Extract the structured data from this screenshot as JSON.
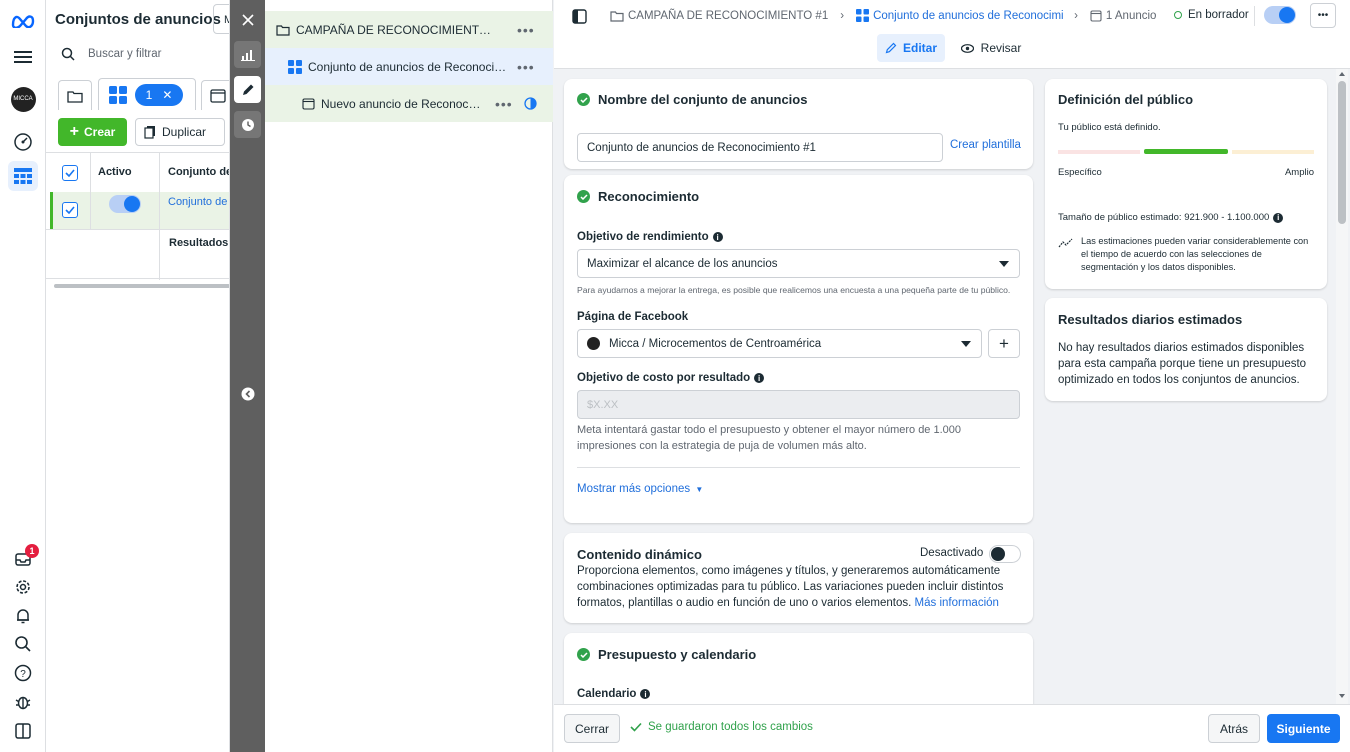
{
  "table_panel": {
    "title": "Conjuntos de anuncios",
    "view_switch_partial": "M",
    "search_placeholder": "Buscar y filtrar",
    "selected_count": "1",
    "create_label": "Crear",
    "duplicate_label": "Duplicar",
    "columns": {
      "active": "Activo",
      "adset": "Conjunto de"
    },
    "row": {
      "name": "Conjunto de"
    },
    "results_label": "Resultados"
  },
  "rail": {
    "avatar_text": "MICCA",
    "notification_count": "1"
  },
  "tree": {
    "campaign": "CAMPAÑA DE RECONOCIMIENTO #1",
    "adset": "Conjunto de anuncios de Reconocimie...",
    "ad": "Nuevo anuncio de Reconocim...",
    "more": "•••"
  },
  "topbar": {
    "crumb_campaign": "CAMPAÑA DE RECONOCIMIENTO #1",
    "crumb_adset": "Conjunto de anuncios de Reconocimie",
    "crumb_ad": "1 Anuncio",
    "status": "En borrador",
    "more": "•••",
    "edit_label": "Editar",
    "review_label": "Revisar"
  },
  "adset_name_card": {
    "title": "Nombre del conjunto de anuncios",
    "value": "Conjunto de anuncios de Reconocimiento #1",
    "template_link": "Crear plantilla"
  },
  "recognition_card": {
    "title": "Reconocimiento",
    "performance_goal_label": "Objetivo de rendimiento",
    "performance_goal_value": "Maximizar el alcance de los anuncios",
    "survey_note": "Para ayudarnos a mejorar la entrega, es posible que realicemos una encuesta a una pequeña parte de tu público.",
    "facebook_page_label": "Página de Facebook",
    "facebook_page_value": "Micca / Microcementos de Centroamérica",
    "cost_goal_label": "Objetivo de costo por resultado",
    "cost_goal_placeholder": "$X.XX",
    "cost_note": "Meta intentará gastar todo el presupuesto y obtener el mayor número de 1.000 impresiones con la estrategia de puja de volumen más alto.",
    "more_options": "Mostrar más opciones"
  },
  "dynamic_card": {
    "title": "Contenido dinámico",
    "toggle_state": "Desactivado",
    "description": "Proporciona elementos, como imágenes y títulos, y generaremos automáticamente combinaciones optimizadas para tu público. Las variaciones pueden incluir distintos formatos, plantillas o audio en función de uno o varios elementos.",
    "more_info": "Más información"
  },
  "budget_card": {
    "title": "Presupuesto y calendario",
    "calendar_label": "Calendario"
  },
  "audience_card": {
    "title": "Definición del público",
    "subtitle": "Tu público está definido.",
    "specific": "Específico",
    "broad": "Amplio",
    "estimated_size": "Tamaño de público estimado: 921.900 - 1.100.000",
    "note": "Las estimaciones pueden variar considerablemente con el tiempo de acuerdo con las selecciones de segmentación y los datos disponibles."
  },
  "daily_results_card": {
    "title": "Resultados diarios estimados",
    "text": "No hay resultados diarios estimados disponibles para esta campaña porque tiene un presupuesto optimizado en todos los conjuntos de anuncios."
  },
  "bottombar": {
    "close": "Cerrar",
    "saved": "Se guardaron todos los cambios",
    "back": "Atrás",
    "next": "Siguiente"
  },
  "colors": {
    "accent": "#1877f2",
    "success": "#42b72a",
    "strip": "#5f5f5f"
  }
}
